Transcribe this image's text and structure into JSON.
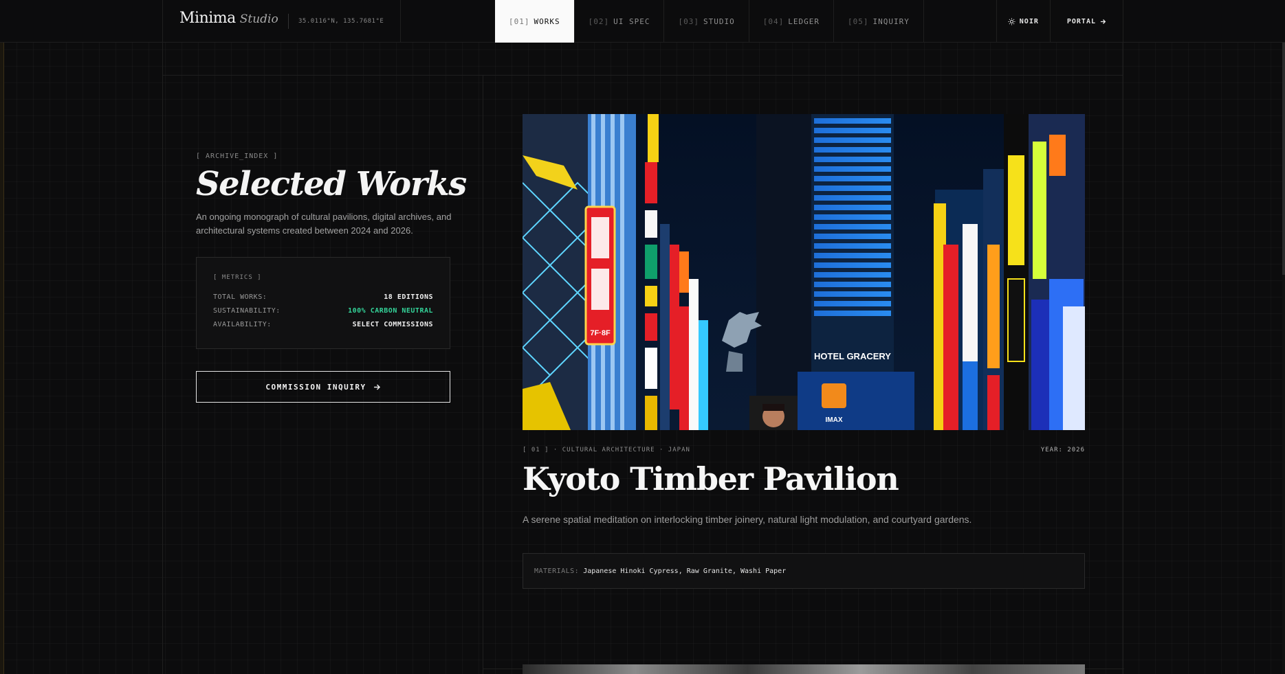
{
  "brand": {
    "name": "Minima",
    "sub": "Studio",
    "coords": "35.0116°N, 135.7681°E"
  },
  "nav": [
    {
      "idx": "[01]",
      "label": "WORKS",
      "active": true
    },
    {
      "idx": "[02]",
      "label": "UI SPEC"
    },
    {
      "idx": "[03]",
      "label": "STUDIO"
    },
    {
      "idx": "[04]",
      "label": "LEDGER"
    },
    {
      "idx": "[05]",
      "label": "INQUIRY"
    }
  ],
  "header_actions": {
    "theme_label": "NOIR",
    "theme_icon": "sun-icon",
    "portal_label": "PORTAL",
    "portal_icon": "arrow-right-icon"
  },
  "sidebar": {
    "kicker": "[ ARCHIVE_INDEX ]",
    "title": "Selected Works",
    "description": "An ongoing monograph of cultural pavilions, digital archives, and architectural systems created between 2024 and 2026.",
    "metrics": {
      "title": "[ METRICS ]",
      "rows": [
        {
          "key": "TOTAL WORKS:",
          "value": "18 EDITIONS"
        },
        {
          "key": "SUSTAINABILITY:",
          "value": "100% CARBON NEUTRAL",
          "color": "#34d399"
        },
        {
          "key": "AVAILABILITY:",
          "value": "SELECT COMMISSIONS"
        }
      ]
    },
    "cta_label": "COMMISSION INQUIRY",
    "cta_icon": "arrow-right-icon"
  },
  "work": {
    "image_text": {
      "hotel": "HOTEL GRACERY",
      "imax": "IMAX",
      "floor": "7F·8F"
    },
    "meta_left": "[ 01 ] · CULTURAL ARCHITECTURE · JAPAN",
    "meta_right": "YEAR: 2026",
    "title": "Kyoto Timber Pavilion",
    "description": "A serene spatial meditation on interlocking timber joinery, natural light modulation, and courtyard gardens.",
    "materials_label": "MATERIALS:",
    "materials_value": "Japanese Hinoki Cypress, Raw Granite, Washi Paper"
  },
  "colors": {
    "accent_green": "#34d399",
    "background": "#0c0c0d",
    "active_tab": "#fafafa"
  }
}
